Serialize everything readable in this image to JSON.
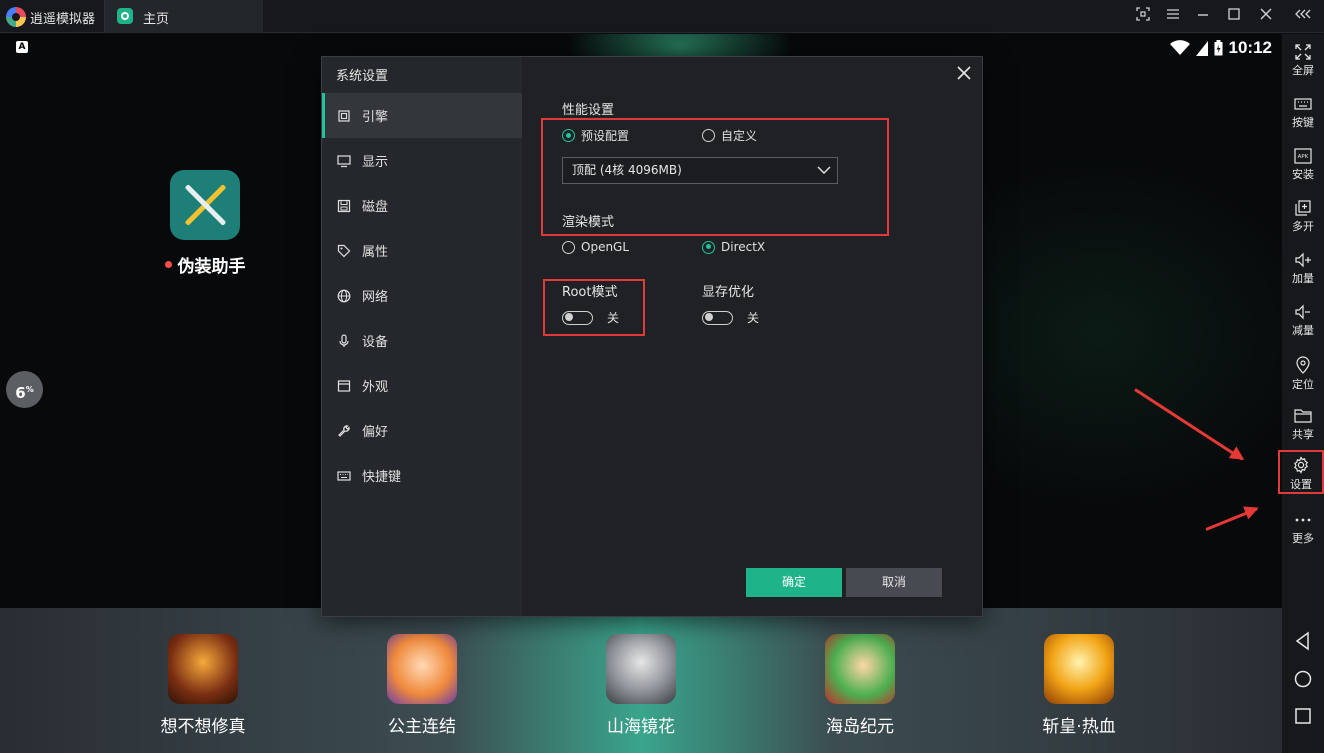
{
  "titlebar": {
    "app_name": "逍遥模拟器",
    "tab_home": "主页",
    "controls": [
      "fullscreen-small-icon",
      "menu-icon",
      "minimize-icon",
      "maximize-icon",
      "close-icon",
      "collapse-icon"
    ]
  },
  "statusbar": {
    "indicator": "A",
    "time": "10:12"
  },
  "desktop": {
    "app_label": "伪装助手",
    "cpu_value": "6",
    "cpu_unit": "%"
  },
  "dock": {
    "apps": [
      {
        "label": "想不想修真"
      },
      {
        "label": "公主连结"
      },
      {
        "label": "山海镜花"
      },
      {
        "label": "海岛纪元"
      },
      {
        "label": "斩皇·热血"
      }
    ]
  },
  "sidebar": {
    "items": [
      {
        "label": "全屏",
        "icon": "fullscreen-icon"
      },
      {
        "label": "按键",
        "icon": "keyboard-icon"
      },
      {
        "label": "安装",
        "icon": "apk-icon"
      },
      {
        "label": "多开",
        "icon": "multi-instance-icon"
      },
      {
        "label": "加量",
        "icon": "volume-up-icon"
      },
      {
        "label": "减量",
        "icon": "volume-down-icon"
      },
      {
        "label": "定位",
        "icon": "location-icon"
      },
      {
        "label": "共享",
        "icon": "folder-icon"
      },
      {
        "label": "设置",
        "icon": "gear-icon"
      },
      {
        "label": "更多",
        "icon": "more-icon"
      }
    ]
  },
  "dialog": {
    "title": "系统设置",
    "nav": [
      {
        "label": "引擎",
        "icon": "chip-icon"
      },
      {
        "label": "显示",
        "icon": "monitor-icon"
      },
      {
        "label": "磁盘",
        "icon": "disk-icon"
      },
      {
        "label": "属性",
        "icon": "tag-icon"
      },
      {
        "label": "网络",
        "icon": "globe-icon"
      },
      {
        "label": "设备",
        "icon": "microphone-icon"
      },
      {
        "label": "外观",
        "icon": "window-icon"
      },
      {
        "label": "偏好",
        "icon": "wrench-icon"
      },
      {
        "label": "快捷键",
        "icon": "keyboard-icon"
      }
    ],
    "performance": {
      "title": "性能设置",
      "option_preset": "预设配置",
      "option_custom": "自定义",
      "selected": "预设配置",
      "dropdown_value": "顶配 (4核 4096MB)"
    },
    "render": {
      "title": "渲染模式",
      "option_opengl": "OpenGL",
      "option_directx": "DirectX",
      "selected": "DirectX"
    },
    "root": {
      "title": "Root模式",
      "state": "关"
    },
    "vram": {
      "title": "显存优化",
      "state": "关"
    },
    "buttons": {
      "ok": "确定",
      "cancel": "取消"
    }
  },
  "colors": {
    "accent": "#1fc69d",
    "highlight_red": "#e03a3a",
    "dialog_bg": "#1f2124",
    "nav_bg": "#24272b"
  }
}
